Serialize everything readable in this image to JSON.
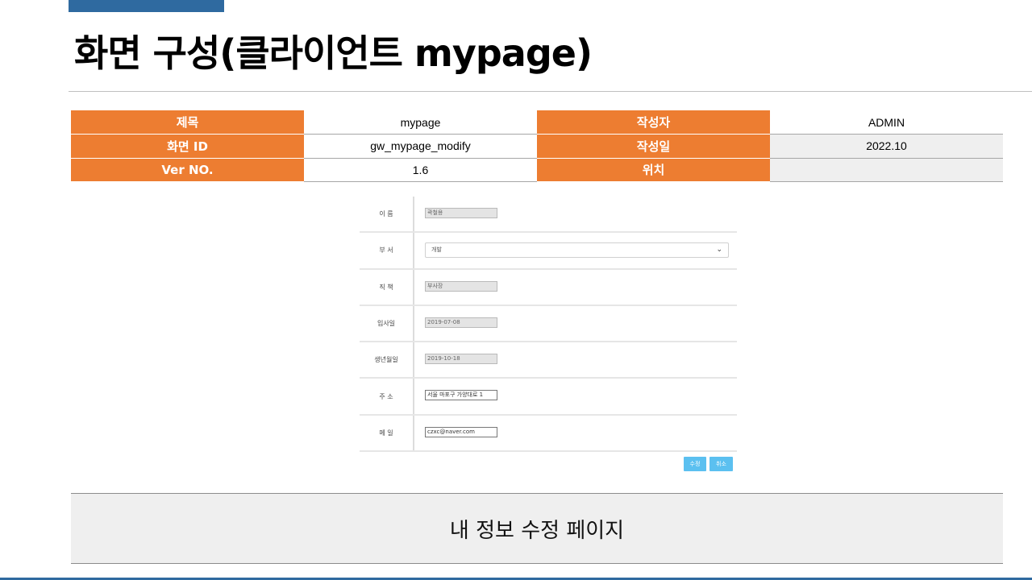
{
  "slide": {
    "title": "화면 구성(클라이언트 mypage)"
  },
  "meta": {
    "rows": [
      {
        "k1": "제목",
        "v1": "mypage",
        "k2": "작성자",
        "v2": "ADMIN"
      },
      {
        "k1": "화면 ID",
        "v1": "gw_mypage_modify",
        "k2": "작성일",
        "v2": "2022.10"
      },
      {
        "k1": "Ver NO.",
        "v1": "1.6",
        "k2": "위치",
        "v2": ""
      }
    ]
  },
  "form": {
    "name_label": "이 름",
    "name_value": "곽철용",
    "dept_label": "부 서",
    "dept_value": "개발",
    "position_label": "직 책",
    "position_value": "부사장",
    "join_label": "입사일",
    "join_value": "2019-07-08",
    "birth_label": "생년월일",
    "birth_value": "2019-10-18",
    "address_label": "주 소",
    "address_value": "서울 마포구 가양대로 1",
    "email_label": "메 일",
    "email_value": "czxc@naver.com",
    "modify_button": "수정",
    "cancel_button": "취소"
  },
  "description": "내 정보 수정 페이지",
  "colors": {
    "accent_blue": "#2f6aa0",
    "header_orange": "#ed7d31",
    "button_blue": "#5bc0f0"
  },
  "icons": {
    "dropdown": "chevron-down-icon"
  }
}
